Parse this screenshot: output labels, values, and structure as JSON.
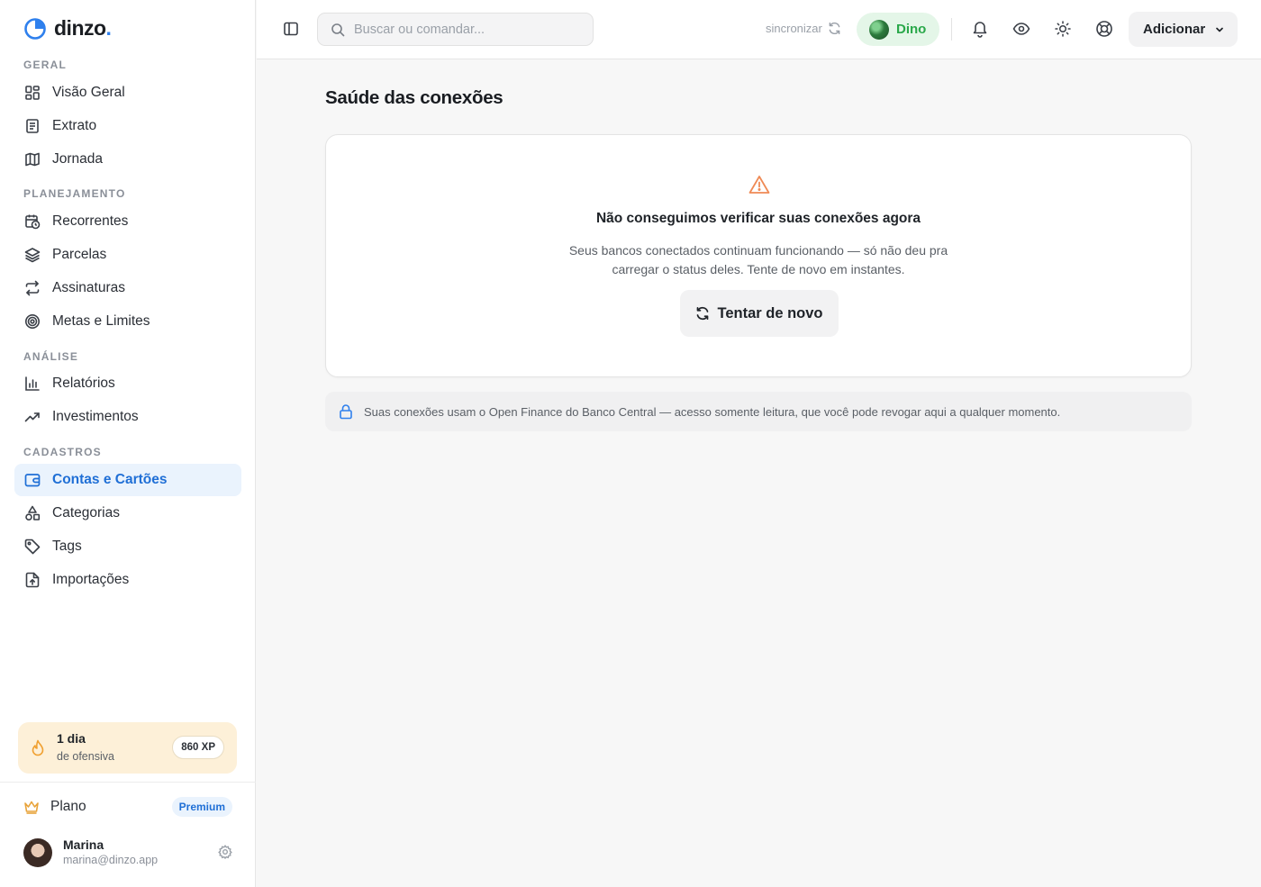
{
  "brand": {
    "name": "dinzo",
    "dot": ".",
    "accent": "#2f80ed"
  },
  "sidebar": {
    "sections": [
      {
        "label": "GERAL"
      },
      {
        "label": "PLANEJAMENTO"
      },
      {
        "label": "ANÁLISE"
      },
      {
        "label": "CADASTROS"
      }
    ],
    "items": [
      {
        "label": "Visão Geral",
        "icon": "dashboard-grid-icon"
      },
      {
        "label": "Extrato",
        "icon": "document-list-icon"
      },
      {
        "label": "Jornada",
        "icon": "map-icon"
      },
      {
        "label": "Recorrentes",
        "icon": "calendar-clock-icon"
      },
      {
        "label": "Parcelas",
        "icon": "layers-icon"
      },
      {
        "label": "Assinaturas",
        "icon": "repeat-arrows-icon"
      },
      {
        "label": "Metas e Limites",
        "icon": "target-icon"
      },
      {
        "label": "Relatórios",
        "icon": "bar-chart-icon"
      },
      {
        "label": "Investimentos",
        "icon": "trend-up-icon"
      },
      {
        "label": "Contas e Cartões",
        "icon": "wallet-icon",
        "active": true
      },
      {
        "label": "Categorias",
        "icon": "shapes-icon"
      },
      {
        "label": "Tags",
        "icon": "tag-icon"
      },
      {
        "label": "Importações",
        "icon": "file-upload-icon"
      }
    ],
    "streak": {
      "days": "1 dia",
      "subtitle": "de ofensiva",
      "xp": "860 XP"
    },
    "plan": {
      "label": "Plano",
      "badge": "Premium"
    },
    "user": {
      "name": "Marina",
      "email": "marina@dinzo.app"
    }
  },
  "topbar": {
    "search_placeholder": "Buscar ou comandar...",
    "sync_label": "sincronizar",
    "assistant_name": "Dino",
    "add_label": "Adicionar"
  },
  "main": {
    "title": "Saúde das conexões",
    "error": {
      "title": "Não conseguimos verificar suas conexões agora",
      "line1": "Seus bancos conectados continuam funcionando — só não deu pra",
      "line2": "carregar o status deles. Tente de novo em instantes.",
      "retry_label": "Tentar de novo"
    },
    "info_text": "Suas conexões usam o Open Finance do Banco Central — acesso somente leitura, que você pode revogar aqui a qualquer momento."
  },
  "colors": {
    "active_bg": "#eaf3fd",
    "active_text": "#1f6fd6",
    "warning": "#ef8a55",
    "assistant_green": "#2aa84a",
    "streak_bg": "#fdf0d8"
  }
}
